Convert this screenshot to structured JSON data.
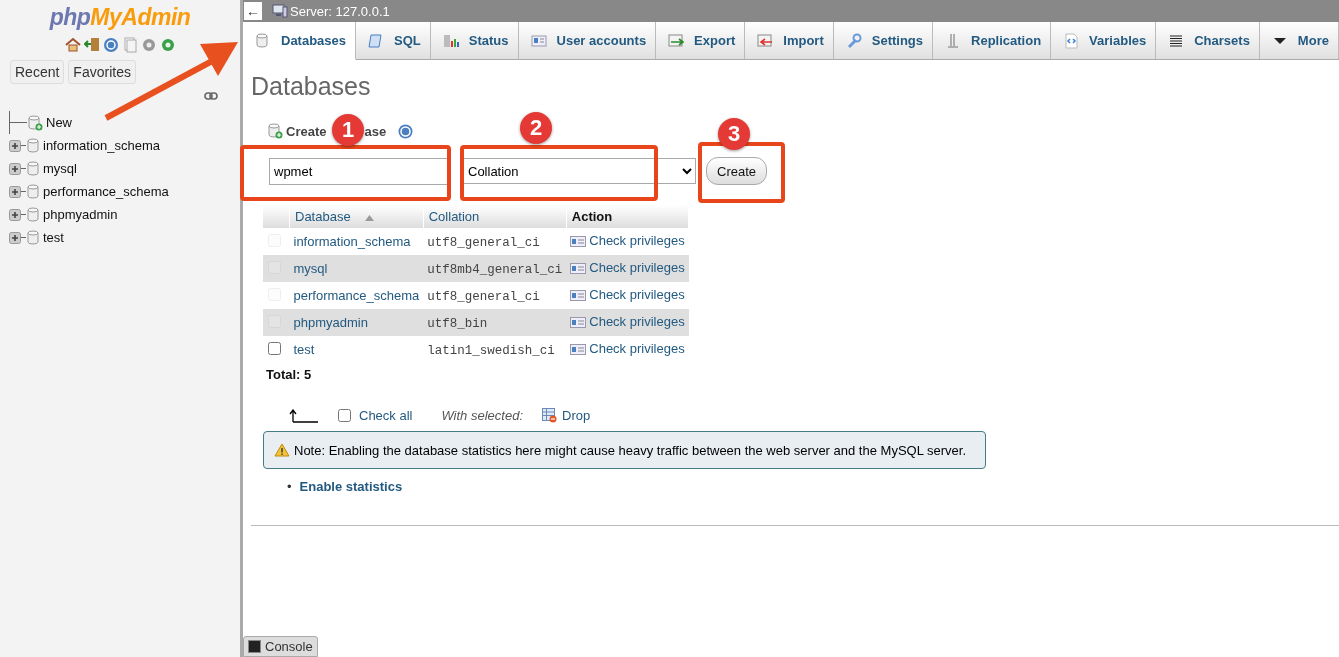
{
  "sidebar": {
    "logo": [
      "php",
      "MyAdmin"
    ],
    "buttons": [
      "Recent",
      "Favorites"
    ],
    "tree": [
      {
        "label": "New",
        "kind": "new"
      },
      {
        "label": "information_schema",
        "kind": "db"
      },
      {
        "label": "mysql",
        "kind": "db"
      },
      {
        "label": "performance_schema",
        "kind": "db"
      },
      {
        "label": "phpmyadmin",
        "kind": "db"
      },
      {
        "label": "test",
        "kind": "db"
      }
    ]
  },
  "top_bar": {
    "back": "←",
    "title": "Server: 127.0.0.1"
  },
  "tabs": [
    {
      "label": "Databases",
      "selected": true
    },
    {
      "label": "SQL",
      "selected": false
    },
    {
      "label": "Status",
      "selected": false
    },
    {
      "label": "User accounts",
      "selected": false
    },
    {
      "label": "Export",
      "selected": false
    },
    {
      "label": "Import",
      "selected": false
    },
    {
      "label": "Settings",
      "selected": false
    },
    {
      "label": "Replication",
      "selected": false
    },
    {
      "label": "Variables",
      "selected": false
    },
    {
      "label": "Charsets",
      "selected": false
    },
    {
      "label": "More",
      "selected": false
    }
  ],
  "page_title": "Databases",
  "create": {
    "label_start": "Create",
    "label_end": "ase",
    "name_value": "wpmet",
    "collation": "Collation",
    "button": "Create"
  },
  "table": {
    "columns": [
      "Database",
      "Collation",
      "Action"
    ],
    "rows": [
      {
        "database": "information_schema",
        "collation": "utf8_general_ci",
        "action": "Check privileges",
        "checked": false,
        "disabled": true
      },
      {
        "database": "mysql",
        "collation": "utf8mb4_general_ci",
        "action": "Check privileges",
        "checked": false,
        "disabled": true
      },
      {
        "database": "performance_schema",
        "collation": "utf8_general_ci",
        "action": "Check privileges",
        "checked": false,
        "disabled": true
      },
      {
        "database": "phpmyadmin",
        "collation": "utf8_bin",
        "action": "Check privileges",
        "checked": false,
        "disabled": true
      },
      {
        "database": "test",
        "collation": "latin1_swedish_ci",
        "action": "Check privileges",
        "checked": false,
        "disabled": false
      }
    ]
  },
  "total": "Total: 5",
  "bulk": {
    "check_all": "Check all",
    "checked": false,
    "with_selected": "With selected:",
    "drop": "Drop"
  },
  "note": "Note: Enabling the database statistics here might cause heavy traffic between the web server and the MySQL server.",
  "links": [
    {
      "bullet": "•",
      "label": "Enable statistics"
    }
  ],
  "console": "Console",
  "annotations": [
    {
      "number": "1"
    },
    {
      "number": "2"
    },
    {
      "number": "3"
    }
  ]
}
